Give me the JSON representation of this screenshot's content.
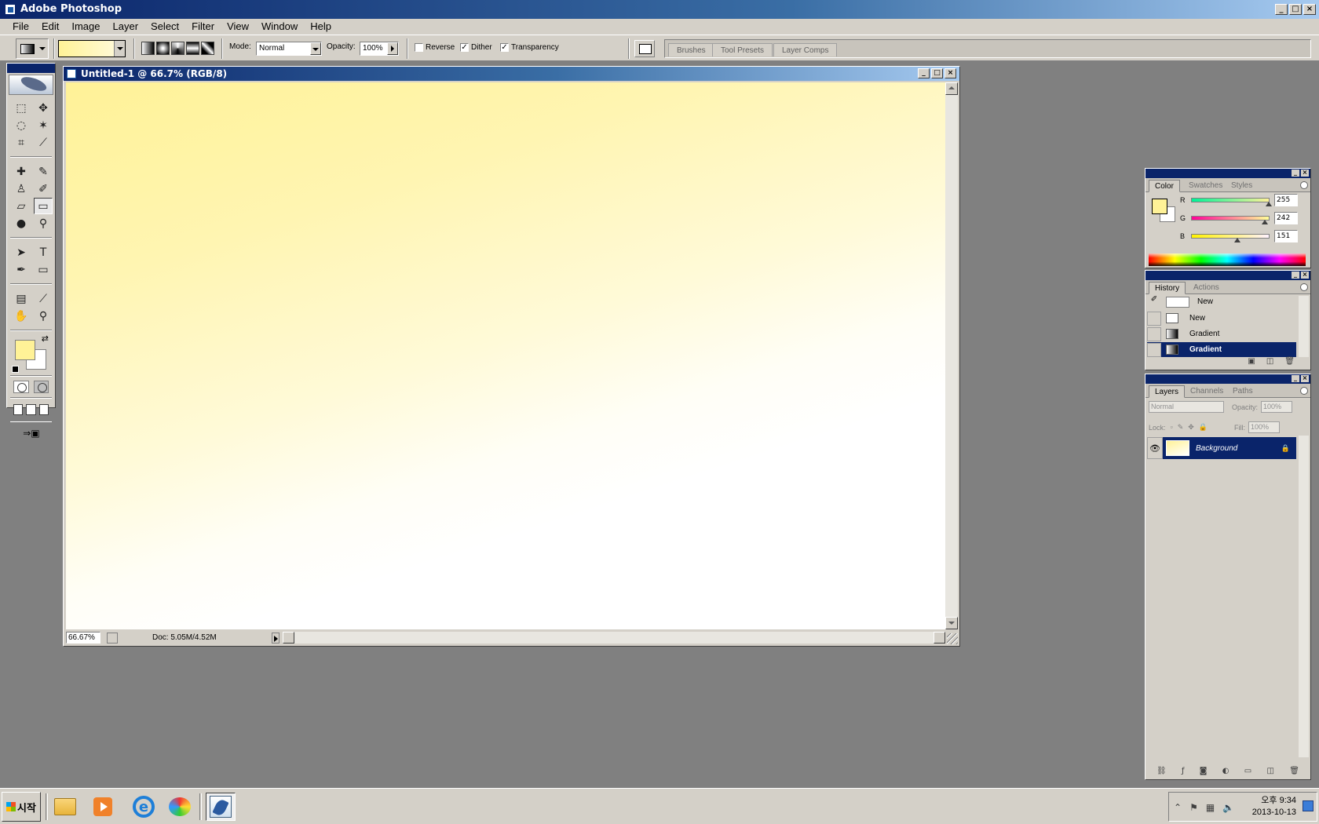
{
  "window": {
    "title": "Adobe Photoshop",
    "controls": [
      "_",
      "□",
      "×"
    ]
  },
  "menu": [
    "File",
    "Edit",
    "Image",
    "Layer",
    "Select",
    "Filter",
    "View",
    "Window",
    "Help"
  ],
  "options": {
    "mode_label": "Mode:",
    "mode_value": "Normal",
    "opacity_label": "Opacity:",
    "opacity_value": "100%",
    "reverse_label": "Reverse",
    "reverse_checked": false,
    "dither_label": "Dither",
    "dither_checked": true,
    "transparency_label": "Transparency",
    "transparency_checked": true,
    "check_mark": "✓",
    "palette_well_tabs": [
      "Brushes",
      "Tool Presets",
      "Layer Comps"
    ]
  },
  "document": {
    "title": "Untitled-1 @ 66.7% (RGB/8)",
    "zoom": "66.67%",
    "doc_info": "Doc: 5.05M/4.52M",
    "gradient_colors": {
      "foreground": "#fff297",
      "background": "#ffffff"
    }
  },
  "color_panel": {
    "tabs": [
      "Color",
      "Swatches",
      "Styles"
    ],
    "channels": [
      {
        "name": "R",
        "value": "255",
        "fraction": 1.0
      },
      {
        "name": "G",
        "value": "242",
        "fraction": 0.949
      },
      {
        "name": "B",
        "value": "151",
        "fraction": 0.592
      }
    ]
  },
  "history_panel": {
    "tabs": [
      "History",
      "Actions"
    ],
    "snapshot_label": "New",
    "items": [
      {
        "label": "New",
        "selected": false
      },
      {
        "label": "Gradient",
        "selected": false
      },
      {
        "label": "Gradient",
        "selected": true
      }
    ]
  },
  "layers_panel": {
    "tabs": [
      "Layers",
      "Channels",
      "Paths"
    ],
    "blend_mode": "Normal",
    "opacity_label": "Opacity:",
    "opacity_value": "100%",
    "lock_label": "Lock:",
    "fill_label": "Fill:",
    "fill_value": "100%",
    "layers": [
      {
        "name": "Background",
        "visible": true,
        "locked": true
      }
    ]
  },
  "taskbar": {
    "start_label": "시작",
    "clock_time": "오후 9:34",
    "clock_date": "2013-10-13"
  },
  "colors": {
    "accent": "#0a246a",
    "chrome": "#d4d0c8",
    "workspace": "#808080",
    "foreground": "#fff297"
  }
}
